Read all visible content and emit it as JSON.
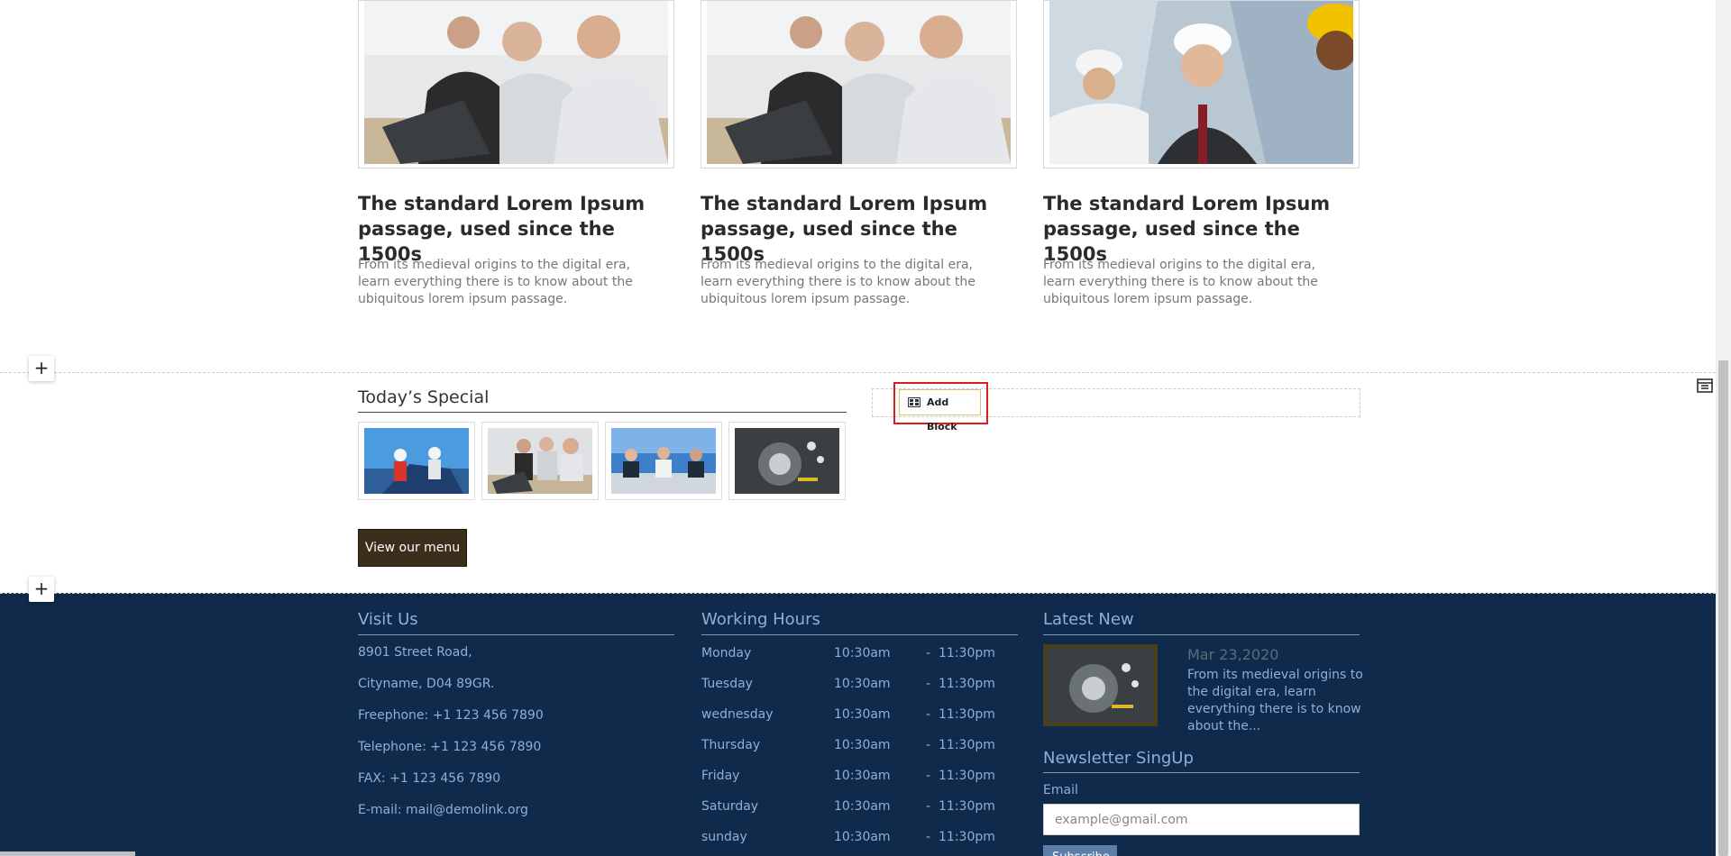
{
  "articles": [
    {
      "title": "The standard Lorem Ipsum passage, used since the 1500s",
      "text": "From its medieval origins to the digital era, learn everything there is to know about the ubiquitous lorem ipsum passage."
    },
    {
      "title": "The standard Lorem Ipsum passage, used since the 1500s",
      "text": "From its medieval origins to the digital era, learn everything there is to know about the ubiquitous lorem ipsum passage."
    },
    {
      "title": "The standard Lorem Ipsum passage, used since the 1500s",
      "text": "From its medieval origins to the digital era, learn everything there is to know about the ubiquitous lorem ipsum passage."
    }
  ],
  "editor": {
    "plus_label": "+",
    "add_block_label": "Add Block"
  },
  "special": {
    "title": "Today’s Special",
    "button_label": "View our menu"
  },
  "footer": {
    "visit": {
      "title": "Visit Us",
      "lines": [
        "8901 Street Road,",
        "Cityname, D04 89GR.",
        "Freephone: +1 123 456 7890",
        "Telephone: +1 123 456 7890",
        "FAX: +1 123 456 7890",
        "E-mail: mail@demolink.org"
      ]
    },
    "hours": {
      "title": "Working Hours",
      "rows": [
        {
          "day": "Monday",
          "open": "10:30am",
          "sep": "-",
          "close": "11:30pm"
        },
        {
          "day": "Tuesday",
          "open": "10:30am",
          "sep": "-",
          "close": "11:30pm"
        },
        {
          "day": "wednesday",
          "open": "10:30am",
          "sep": "-",
          "close": "11:30pm"
        },
        {
          "day": "Thursday",
          "open": "10:30am",
          "sep": "-",
          "close": "11:30pm"
        },
        {
          "day": "Friday",
          "open": "10:30am",
          "sep": "-",
          "close": "11:30pm"
        },
        {
          "day": "Saturday",
          "open": "10:30am",
          "sep": "-",
          "close": "11:30pm"
        },
        {
          "day": "sunday",
          "open": "10:30am",
          "sep": "-",
          "close": "11:30pm"
        }
      ]
    },
    "latest": {
      "title": "Latest New",
      "date": "Mar 23,2020",
      "text": "From its medieval origins to the digital era, learn everything there is to know about the..."
    },
    "newsletter": {
      "title": "Newsletter SingUp",
      "email_label": "Email",
      "email_placeholder": "example@gmail.com",
      "subscribe_label": "Subscribe"
    }
  },
  "colors": {
    "footer_bg": "#0f2a4a",
    "footer_text": "#8fb0d6",
    "button_bg": "#3b2f1b",
    "highlight": "#e11b1b"
  }
}
